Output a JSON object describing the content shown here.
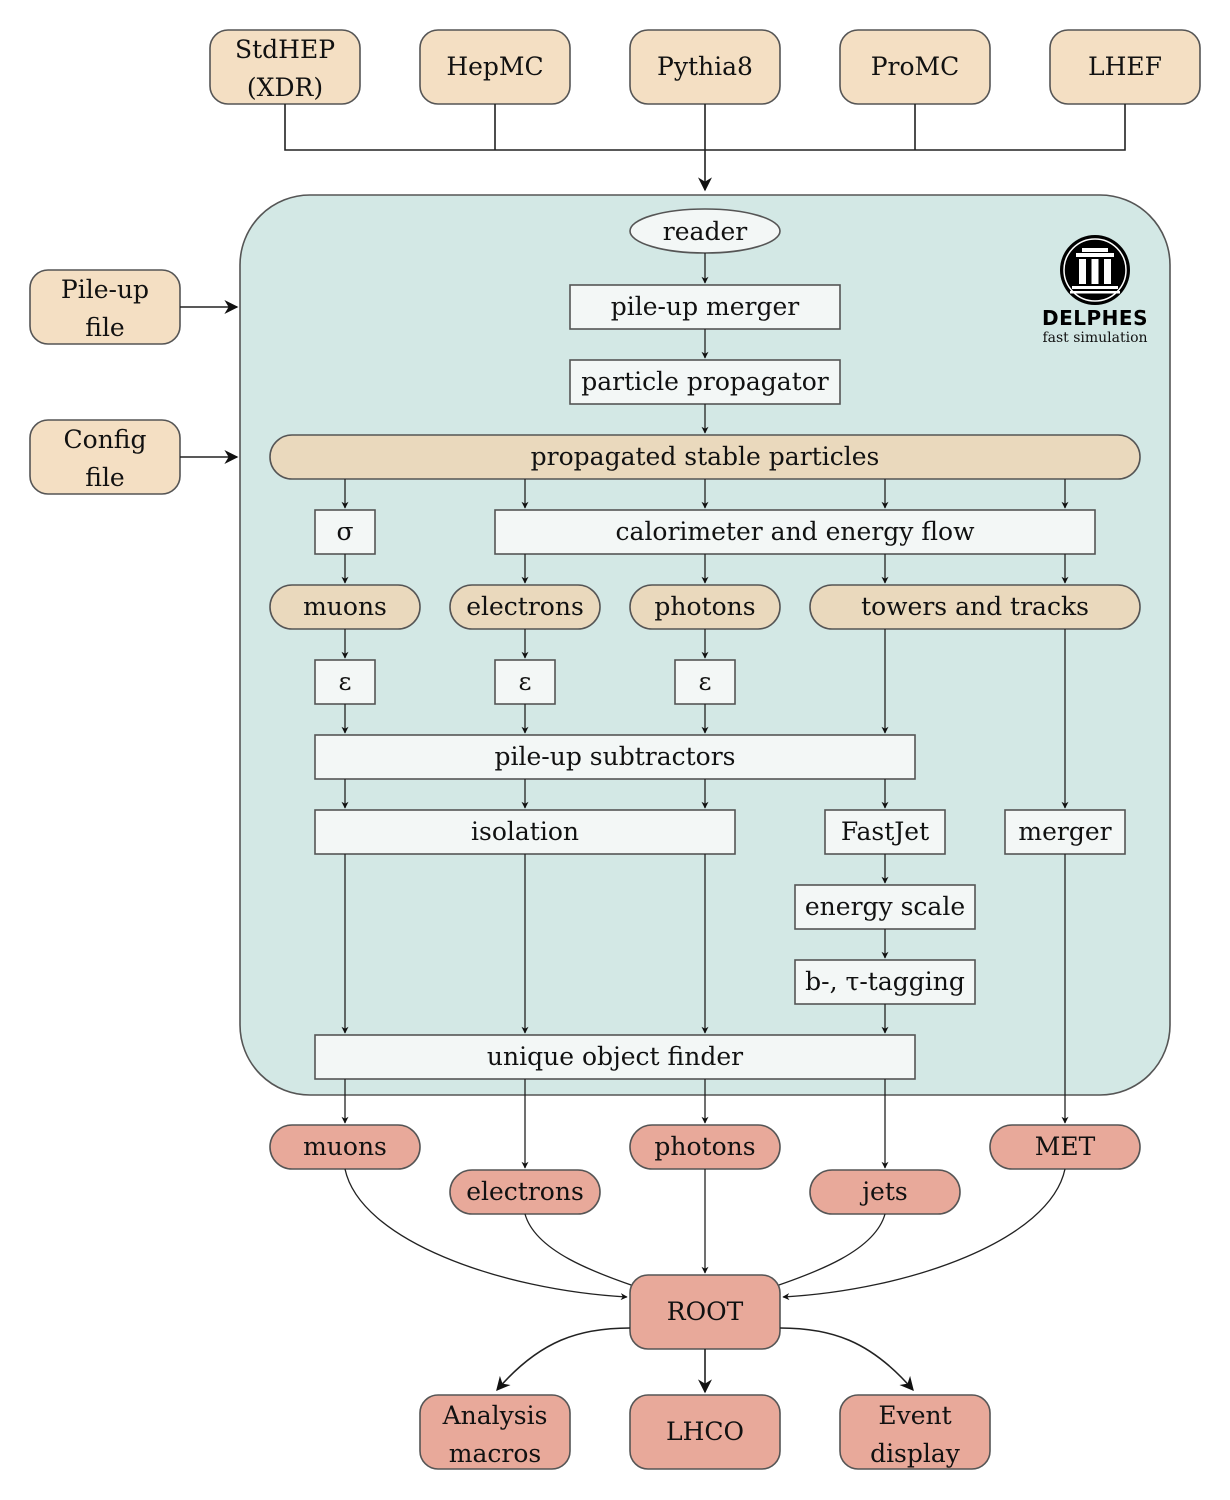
{
  "inputs": {
    "formats": [
      {
        "label_lines": [
          "StdHEP",
          "(XDR)"
        ]
      },
      {
        "label_lines": [
          "HepMC"
        ]
      },
      {
        "label_lines": [
          "Pythia8"
        ]
      },
      {
        "label_lines": [
          "ProMC"
        ]
      },
      {
        "label_lines": [
          "LHEF"
        ]
      }
    ],
    "pileup_file": [
      "Pile-up",
      "file"
    ],
    "config_file": [
      "Config",
      "file"
    ]
  },
  "logo": {
    "icon": "greek-temple-icon",
    "title": "DELPHES",
    "subtitle": "fast simulation"
  },
  "pipeline": {
    "reader": "reader",
    "pileup_merger": "pile-up merger",
    "particle_propagator": "particle propagator",
    "propagated_stable_particles": "propagated stable particles",
    "sigma": "σ",
    "calorimeter": "calorimeter and energy flow",
    "muons": "muons",
    "electrons": "electrons",
    "photons": "photons",
    "towers_tracks": "towers and tracks",
    "efficiency": "ε",
    "pileup_subtractors": "pile-up subtractors",
    "isolation": "isolation",
    "fastjet": "FastJet",
    "merger": "merger",
    "energy_scale": "energy scale",
    "btau_tagging": "b-, τ-tagging",
    "unique_object_finder": "unique object finder"
  },
  "outputs": {
    "muons": "muons",
    "electrons": "electrons",
    "photons": "photons",
    "jets": "jets",
    "met": "MET",
    "root": "ROOT",
    "analysis_macros": [
      "Analysis",
      "macros"
    ],
    "lhco": "LHCO",
    "event_display": [
      "Event",
      "display"
    ]
  },
  "colors": {
    "input_fill": "#f4dfc3",
    "container_fill": "#d3e8e5",
    "module_fill": "#f3f7f6",
    "collection_fill": "#ead9bd",
    "output_fill": "#e8a99a"
  }
}
